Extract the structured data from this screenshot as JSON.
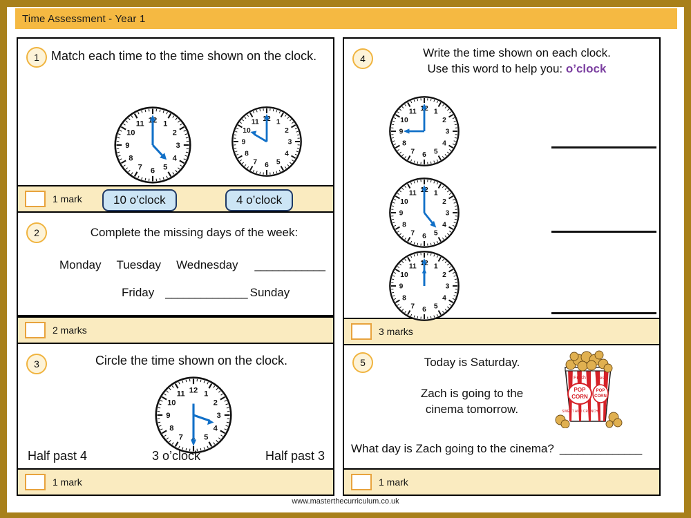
{
  "header": {
    "title": "Time Assessment - Year 1"
  },
  "footer": {
    "url": "www.masterthecurriculum.co.uk"
  },
  "questions": [
    {
      "number": "1",
      "prompt": "Match each time to the time shown on the clock.",
      "clocks": [
        {
          "hour": 4,
          "minute": 0,
          "label": "clock-4-oclock"
        },
        {
          "hour": 10,
          "minute": 0,
          "label": "clock-10-oclock"
        }
      ],
      "chips": [
        "10 o’clock",
        "4 o’clock"
      ],
      "marks": "1 mark"
    },
    {
      "number": "2",
      "prompt": "Complete the missing days of the week:",
      "row1": [
        "Monday",
        "Tuesday",
        "Wednesday",
        "____________"
      ],
      "row2": [
        "Friday",
        "______________",
        "Sunday"
      ],
      "marks": "2 marks"
    },
    {
      "number": "3",
      "prompt": "Circle the time shown on the clock.",
      "clock": {
        "hour": 3,
        "minute": 30
      },
      "options": [
        "Half past 4",
        "3 o’clock",
        "Half past 3"
      ],
      "marks": "1 mark"
    },
    {
      "number": "4",
      "prompt_line1": "Write the time shown on each clock.",
      "prompt_line2_prefix": "Use this word to help you: ",
      "hint_word": "o’clock",
      "clocks": [
        {
          "hour": 9,
          "minute": 0
        },
        {
          "hour": 4,
          "minute": 0
        },
        {
          "hour": 12,
          "minute": 0
        }
      ],
      "marks": "3 marks"
    },
    {
      "number": "5",
      "line1": "Today is Saturday.",
      "line2": "Zach is going to the",
      "line3": "cinema tomorrow.",
      "question": "What day is Zach going to the cinema?",
      "answer_line": "______________",
      "image": "popcorn-box",
      "marks": "1 mark"
    }
  ],
  "colors": {
    "page_border": "#A8801A",
    "header_bg": "#F5B942",
    "marks_bg": "#FAEBC0",
    "mark_box_border": "#E8A33D",
    "badge_bg": "#FDF3D8",
    "badge_border": "#F0B440",
    "chip_bg": "#CCE5F5",
    "chip_border": "#1F3864",
    "hand_blue": "#1170C8",
    "hint_purple": "#7B3FA0",
    "popcorn_red": "#D62229",
    "popcorn_kernel": "#D9A441"
  }
}
